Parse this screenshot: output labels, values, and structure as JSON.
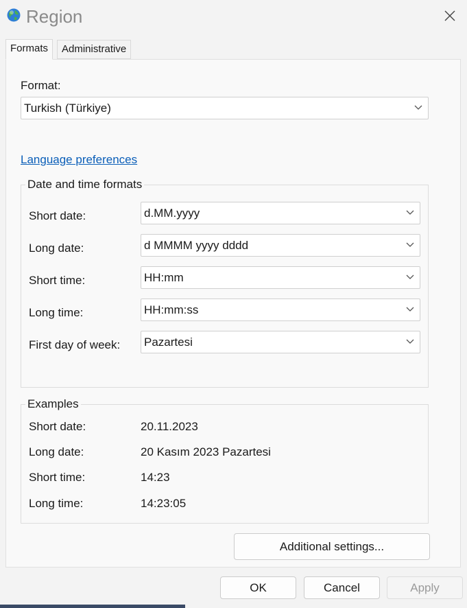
{
  "window": {
    "title": "Region",
    "icon": "globe-icon",
    "close_icon": "close-icon"
  },
  "tabs": [
    {
      "label": "Formats",
      "active": true
    },
    {
      "label": "Administrative",
      "active": false
    }
  ],
  "format": {
    "label": "Format:",
    "value": "Turkish (Türkiye)"
  },
  "language_link": "Language preferences",
  "date_time_formats": {
    "title": "Date and time formats",
    "rows": [
      {
        "label": "Short date:",
        "value": "d.MM.yyyy"
      },
      {
        "label": "Long date:",
        "value": "d MMMM yyyy dddd"
      },
      {
        "label": "Short time:",
        "value": "HH:mm"
      },
      {
        "label": "Long time:",
        "value": "HH:mm:ss"
      },
      {
        "label": "First day of week:",
        "value": "Pazartesi"
      }
    ]
  },
  "examples": {
    "title": "Examples",
    "rows": [
      {
        "label": "Short date:",
        "value": "20.11.2023"
      },
      {
        "label": "Long date:",
        "value": "20 Kasım 2023 Pazartesi"
      },
      {
        "label": "Short time:",
        "value": "14:23"
      },
      {
        "label": "Long time:",
        "value": "14:23:05"
      }
    ]
  },
  "additional_settings_label": "Additional settings...",
  "buttons": {
    "ok": "OK",
    "cancel": "Cancel",
    "apply": "Apply"
  },
  "colors": {
    "link": "#0a5eb8",
    "disabled_text": "#9a9a9a"
  }
}
